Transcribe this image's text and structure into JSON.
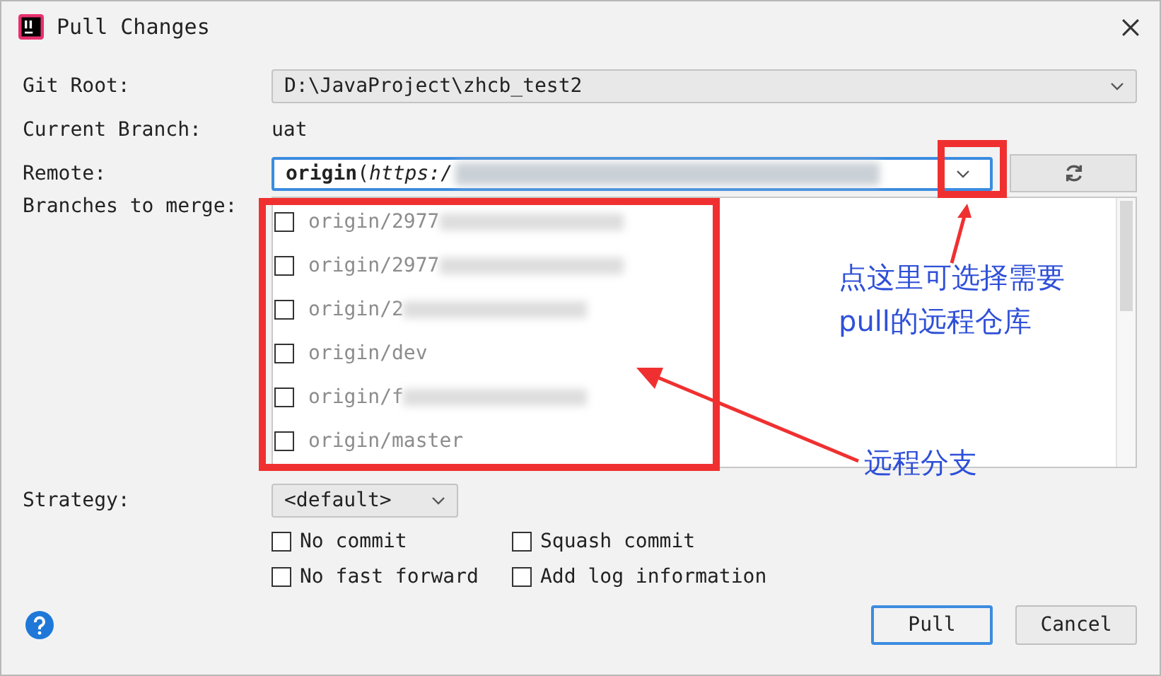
{
  "window": {
    "title": "Pull Changes"
  },
  "form": {
    "git_root": {
      "label": "Git Root:",
      "value": "D:\\JavaProject\\zhcb_test2"
    },
    "current_branch": {
      "label": "Current Branch:",
      "value": "uat"
    },
    "remote": {
      "label": "Remote:",
      "value": "**origin**(*https:/*"
    },
    "branches": {
      "label": "Branches to merge:",
      "items": [
        {
          "name": "origin/2977",
          "checked": false
        },
        {
          "name": "origin/2977",
          "checked": false
        },
        {
          "name": "origin/2",
          "checked": false
        },
        {
          "name": "origin/dev",
          "checked": false
        },
        {
          "name": "origin/f",
          "checked": false
        },
        {
          "name": "origin/master",
          "checked": false
        }
      ]
    },
    "strategy": {
      "label": "Strategy:",
      "value": "<default>"
    },
    "options": [
      {
        "label": "No commit",
        "checked": false
      },
      {
        "label": "Squash commit",
        "checked": false
      },
      {
        "label": "No fast forward",
        "checked": false
      },
      {
        "label": "Add log information",
        "checked": false
      }
    ]
  },
  "buttons": [
    {
      "label": "Pull",
      "default": true
    },
    {
      "label": "Cancel",
      "default": false
    }
  ],
  "annotations": [
    {
      "text": "点这里可选择需要pull的远程仓库"
    },
    {
      "text": "远程分支"
    }
  ]
}
